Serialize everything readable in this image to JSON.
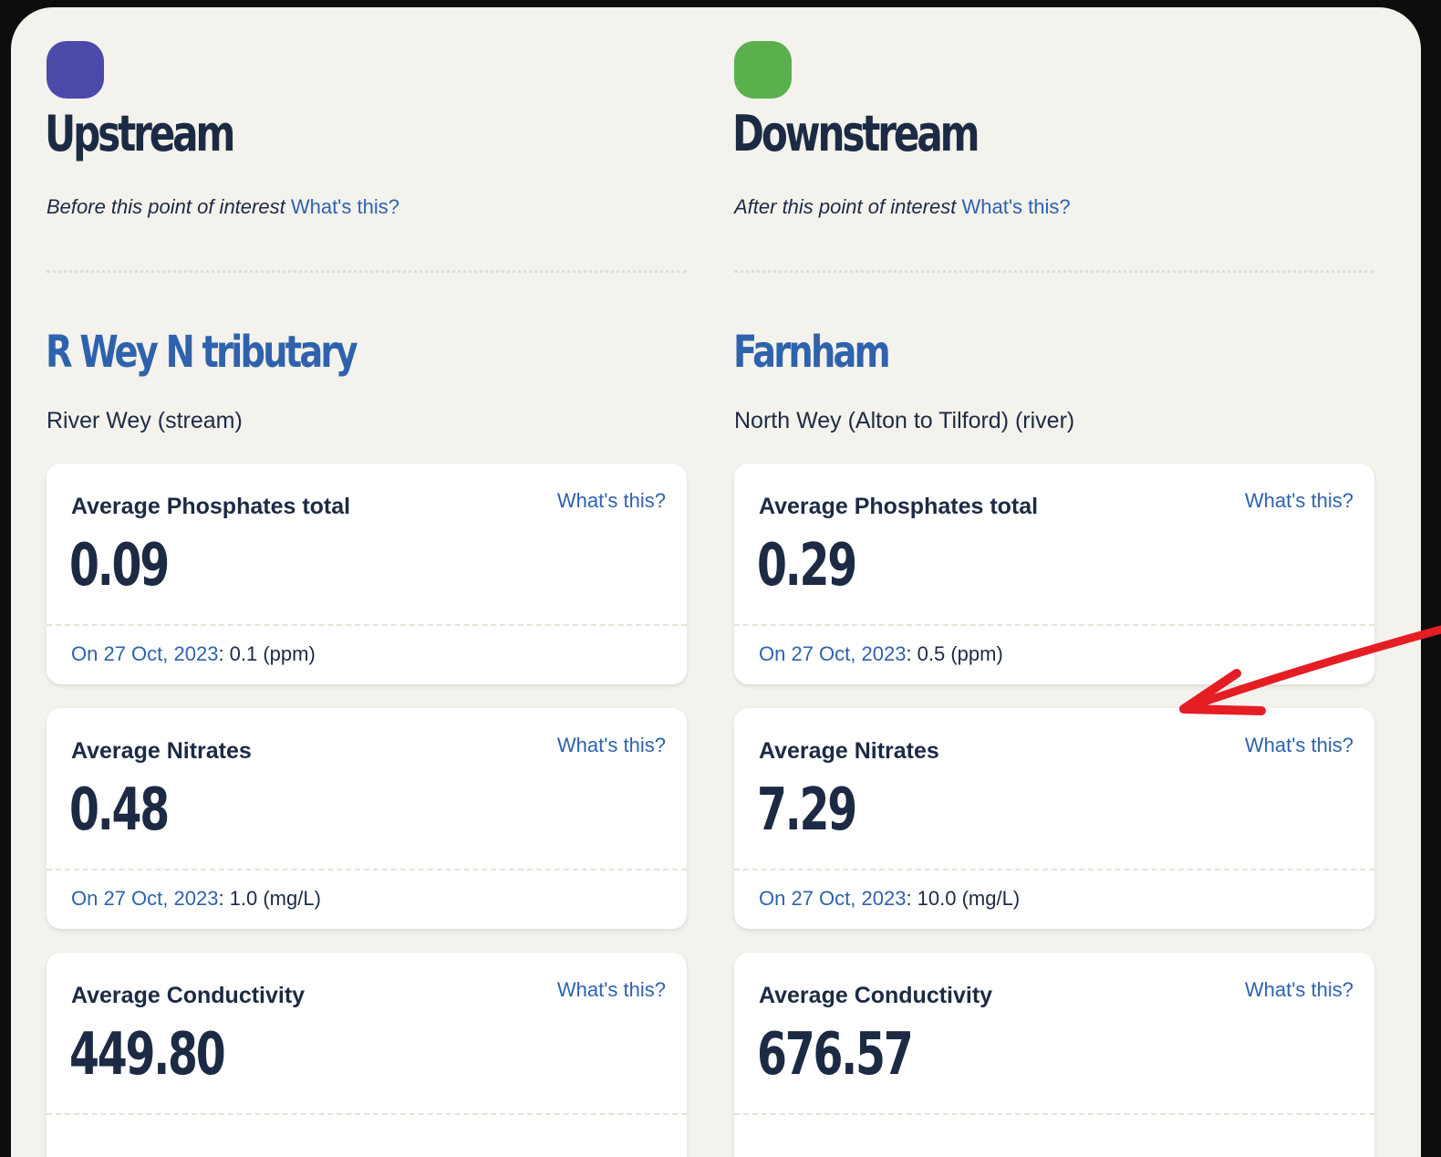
{
  "colors": {
    "upstream_marker": "#4b4aa9",
    "downstream_marker": "#5bb04e",
    "link": "#2f62ad",
    "text": "#1d2a44",
    "annotation_arrow": "#e51d24"
  },
  "upstream": {
    "title": "Upstream",
    "subtitle": "Before this point of interest",
    "help_link": "What's this?",
    "site_name": "R Wey N tributary",
    "water_body": "River Wey (stream)",
    "cards": [
      {
        "label": "Average Phosphates total",
        "help": "What's this?",
        "value": "0.09",
        "date_link": "On 27 Oct, 2023",
        "reading": ": 0.1 (ppm)"
      },
      {
        "label": "Average Nitrates",
        "help": "What's this?",
        "value": "0.48",
        "date_link": "On 27 Oct, 2023",
        "reading": ": 1.0 (mg/L)"
      },
      {
        "label": "Average Conductivity",
        "help": "What's this?",
        "value": "449.80"
      }
    ]
  },
  "downstream": {
    "title": "Downstream",
    "subtitle": "After this point of interest",
    "help_link": "What's this?",
    "site_name": "Farnham",
    "water_body": "North Wey (Alton to Tilford) (river)",
    "cards": [
      {
        "label": "Average Phosphates total",
        "help": "What's this?",
        "value": "0.29",
        "date_link": "On 27 Oct, 2023",
        "reading": ": 0.5 (ppm)"
      },
      {
        "label": "Average Nitrates",
        "help": "What's this?",
        "value": "7.29",
        "date_link": "On 27 Oct, 2023",
        "reading": ": 10.0 (mg/L)"
      },
      {
        "label": "Average Conductivity",
        "help": "What's this?",
        "value": "676.57"
      }
    ]
  }
}
